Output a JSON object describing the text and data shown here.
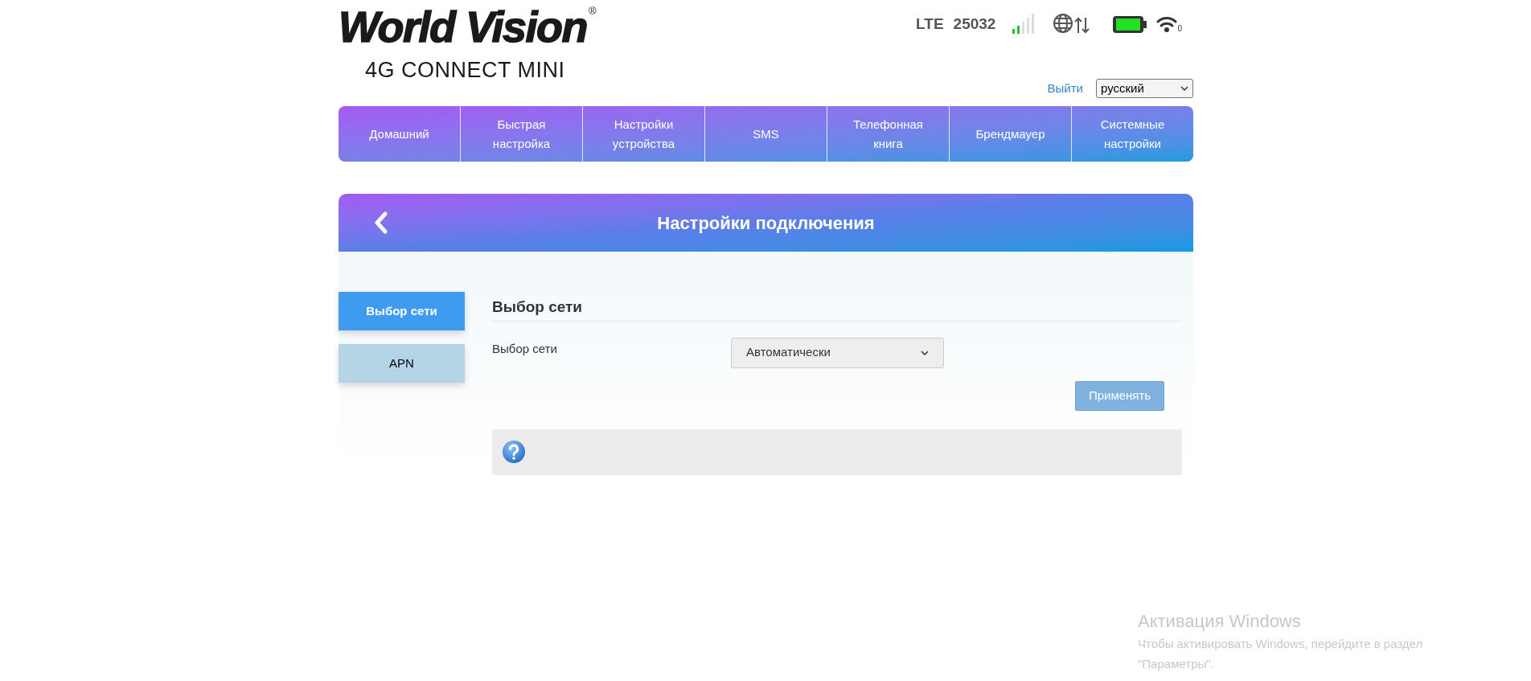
{
  "brand": {
    "name": "World Vision",
    "mark": "®",
    "model": "4G CONNECT MINI"
  },
  "status": {
    "network": "LTE",
    "operator": "25032",
    "wifi_clients": "0"
  },
  "top_links": {
    "logout": "Выйти",
    "language": "русский"
  },
  "nav": [
    {
      "label": "Домашний"
    },
    {
      "label": "Быстрая настройка"
    },
    {
      "label": "Настройки устройства"
    },
    {
      "label": "SMS"
    },
    {
      "label": "Телефонная книга"
    },
    {
      "label": "Брендмауер"
    },
    {
      "label": "Системные настройки"
    }
  ],
  "page": {
    "title": "Настройки подключения"
  },
  "side_tabs": [
    {
      "label": "Выбор сети",
      "selected": true
    },
    {
      "label": "APN",
      "selected": false
    }
  ],
  "section": {
    "title": "Выбор сети",
    "field_label": "Выбор сети",
    "field_value": "Автоматически",
    "apply": "Применять"
  },
  "activation": {
    "title": "Активация Windows",
    "text": "Чтобы активировать Windows, перейдите в раздел \"Параметры\"."
  }
}
